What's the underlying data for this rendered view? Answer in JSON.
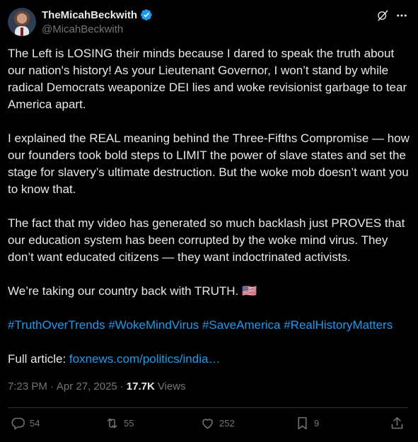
{
  "author": {
    "display_name": "TheMicahBeckwith",
    "handle": "@MicahBeckwith"
  },
  "post": {
    "paragraphs": [
      "The Left is LOSING their minds because I dared to speak the truth about our nation's history! As your Lieutenant Governor, I won’t stand by while radical Democrats weaponize DEI lies and woke revisionist garbage to tear America apart.",
      "I explained the REAL meaning behind the Three-Fifths Compromise — how our founders took bold steps to LIMIT the power of slave states and set the stage for slavery’s ultimate destruction. But the woke mob doesn’t want you to know that.",
      "The fact that my video has generated so much backlash just PROVES that our education system has been corrupted by the woke mind virus. They don’t want educated citizens — they want indoctrinated activists.",
      "We’re taking our country back with TRUTH. 🇺🇸"
    ],
    "hashtags": "#TruthOverTrends #WokeMindVirus #SaveAmerica #RealHistoryMatters",
    "article_prefix": "Full article: ",
    "article_link": "foxnews.com/politics/india…"
  },
  "meta": {
    "time": "7:23 PM",
    "separator": "·",
    "date": "Apr 27, 2025",
    "views_count": "17.7K",
    "views_label": "Views"
  },
  "actions": {
    "replies": "54",
    "reposts": "55",
    "likes": "252",
    "bookmarks": "9"
  },
  "colors": {
    "background": "#000000",
    "text": "#e7e9ea",
    "muted": "#71767b",
    "accent": "#1d9bf0",
    "divider": "#2f3336"
  },
  "icons": [
    "verified-badge-icon",
    "grok-icon",
    "more-icon",
    "reply-icon",
    "repost-icon",
    "like-icon",
    "bookmark-icon",
    "share-icon"
  ]
}
